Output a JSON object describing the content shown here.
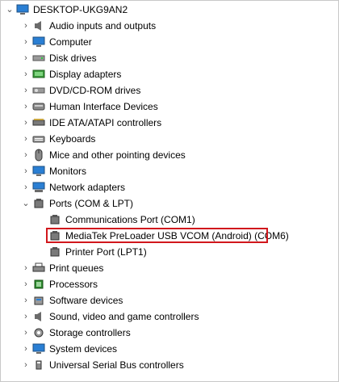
{
  "root": {
    "label": "DESKTOP-UKG9AN2",
    "icon": "computer-icon",
    "expanded": true
  },
  "items": [
    {
      "label": "Audio inputs and outputs",
      "icon": "speaker-icon",
      "expanded": false
    },
    {
      "label": "Computer",
      "icon": "monitor-icon",
      "expanded": false
    },
    {
      "label": "Disk drives",
      "icon": "disk-drive-icon",
      "expanded": false
    },
    {
      "label": "Display adapters",
      "icon": "display-adapter-icon",
      "expanded": false
    },
    {
      "label": "DVD/CD-ROM drives",
      "icon": "optical-drive-icon",
      "expanded": false
    },
    {
      "label": "Human Interface Devices",
      "icon": "hid-icon",
      "expanded": false
    },
    {
      "label": "IDE ATA/ATAPI controllers",
      "icon": "ide-controller-icon",
      "expanded": false
    },
    {
      "label": "Keyboards",
      "icon": "keyboard-icon",
      "expanded": false
    },
    {
      "label": "Mice and other pointing devices",
      "icon": "mouse-icon",
      "expanded": false
    },
    {
      "label": "Monitors",
      "icon": "monitor-icon",
      "expanded": false
    },
    {
      "label": "Network adapters",
      "icon": "network-icon",
      "expanded": false
    },
    {
      "label": "Ports (COM & LPT)",
      "icon": "port-icon",
      "expanded": true,
      "children": [
        {
          "label": "Communications Port (COM1)",
          "icon": "port-icon"
        },
        {
          "label": "MediaTek PreLoader USB VCOM (Android) (COM6)",
          "icon": "port-icon",
          "highlighted": true
        },
        {
          "label": "Printer Port (LPT1)",
          "icon": "port-icon"
        }
      ]
    },
    {
      "label": "Print queues",
      "icon": "printer-icon",
      "expanded": false
    },
    {
      "label": "Processors",
      "icon": "processor-icon",
      "expanded": false
    },
    {
      "label": "Software devices",
      "icon": "software-device-icon",
      "expanded": false
    },
    {
      "label": "Sound, video and game controllers",
      "icon": "sound-icon",
      "expanded": false
    },
    {
      "label": "Storage controllers",
      "icon": "storage-controller-icon",
      "expanded": false
    },
    {
      "label": "System devices",
      "icon": "system-device-icon",
      "expanded": false
    },
    {
      "label": "Universal Serial Bus controllers",
      "icon": "usb-icon",
      "expanded": false
    }
  ],
  "colors": {
    "highlight_border": "#d1171c",
    "icon_blue": "#2a7fd4",
    "icon_gray": "#6b6b6b"
  }
}
